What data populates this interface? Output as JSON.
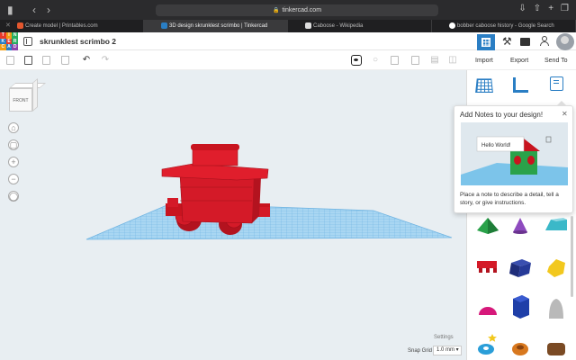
{
  "browser": {
    "address": "tinkercad.com",
    "tabs": [
      {
        "label": "Create model | Printables.com",
        "favicon_color": "#e4572e"
      },
      {
        "label": "3D design skrunklest scrimbo | Tinkercad",
        "favicon_color": "#2a7ec4"
      },
      {
        "label": "Caboose - Wikipedia",
        "favicon_color": "#dddddd"
      },
      {
        "label": "bobber caboose history - Google Search",
        "favicon_color": "#ffffff"
      }
    ]
  },
  "app": {
    "logo_letters": [
      "T",
      "I",
      "N",
      "K",
      "E",
      "R",
      "C",
      "A",
      "D"
    ],
    "logo_colors": [
      "#e8392a",
      "#f39c12",
      "#27ae60",
      "#2a7ec4",
      "#e8392a",
      "#27ae60",
      "#f39c12",
      "#2a7ec4",
      "#8e44ad"
    ],
    "design_title": "skrunklest scrimbo 2"
  },
  "toolbar": {
    "import_label": "Import",
    "export_label": "Export",
    "send_to_label": "Send To"
  },
  "viewcube": {
    "front_label": "FRONT"
  },
  "workplane": {
    "settings_label": "Settings",
    "snap_grid_label": "Snap Grid",
    "snap_grid_value": "1.0 mm ▾"
  },
  "callout": {
    "title": "Add Notes to your design!",
    "note_text": "Hello World!",
    "description": "Place a note to describe a detail, tell a story, or give instructions."
  },
  "shapes": [
    {
      "icon": "pyramid-green-icon"
    },
    {
      "icon": "cone-purple-icon"
    },
    {
      "icon": "roof-teal-icon"
    },
    {
      "icon": "text-red-icon"
    },
    {
      "icon": "box-navy-icon"
    },
    {
      "icon": "hexagonal-prism-yellow-icon"
    },
    {
      "icon": "half-sphere-magenta-icon"
    },
    {
      "icon": "polygon-blue-icon"
    },
    {
      "icon": "paraboloid-gray-icon"
    },
    {
      "icon": "torus-blue-icon"
    },
    {
      "icon": "tube-orange-icon"
    },
    {
      "icon": "rounded-box-brown-icon"
    }
  ]
}
